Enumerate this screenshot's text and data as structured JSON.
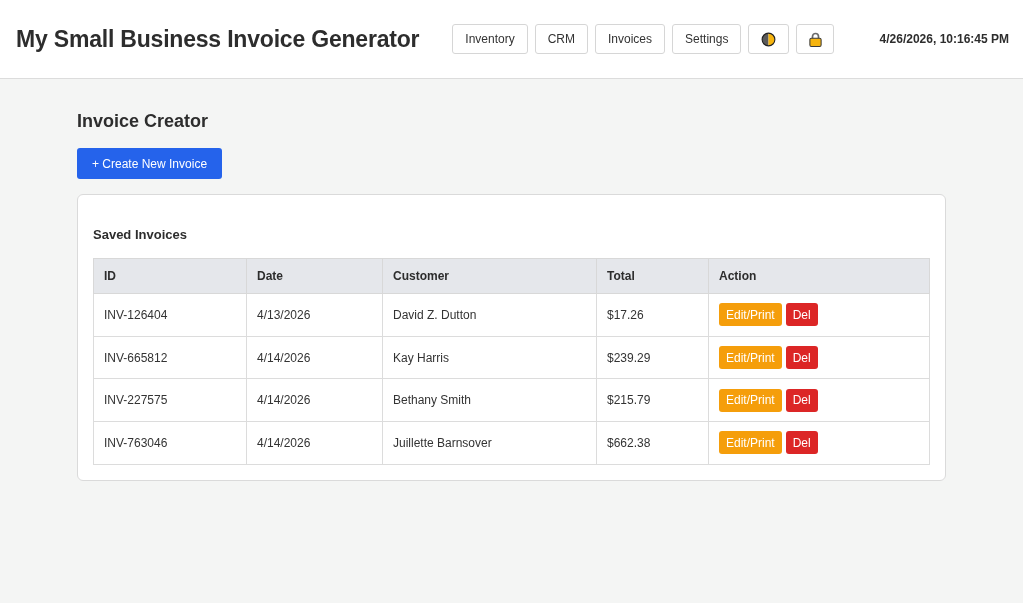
{
  "header": {
    "title": "My Small Business Invoice Generator",
    "nav": [
      "Inventory",
      "CRM",
      "Invoices",
      "Settings"
    ],
    "datetime": "4/26/2026, 10:16:45 PM"
  },
  "main": {
    "title": "Invoice Creator",
    "create_button": "+ Create New Invoice"
  },
  "saved_invoices": {
    "title": "Saved Invoices",
    "columns": [
      "ID",
      "Date",
      "Customer",
      "Total",
      "Action"
    ],
    "rows": [
      {
        "id": "INV-126404",
        "date": "4/13/2026",
        "customer": "David Z. Dutton",
        "total": "$17.26",
        "actions": [
          {
            "kind": "edit",
            "label": "Edit/Print"
          },
          {
            "kind": "delete",
            "label": "Del"
          }
        ]
      },
      {
        "id": "INV-665812",
        "date": "4/14/2026",
        "customer": "Kay Harris",
        "total": "$239.29",
        "actions": [
          {
            "kind": "edit",
            "label": "Edit/Print"
          },
          {
            "kind": "delete",
            "label": "Del"
          }
        ]
      },
      {
        "id": "INV-227575",
        "date": "4/14/2026",
        "customer": "Bethany Smith",
        "total": "$215.79",
        "actions": [
          {
            "kind": "edit",
            "label": "Edit/Print"
          },
          {
            "kind": "delete",
            "label": "Del"
          }
        ]
      },
      {
        "id": "INV-763046",
        "date": "4/14/2026",
        "customer": "Juillette Barnsover",
        "total": "$662.38",
        "actions": [
          {
            "kind": "edit",
            "label": "Edit/Print"
          },
          {
            "kind": "delete",
            "label": "Del"
          }
        ]
      }
    ]
  }
}
